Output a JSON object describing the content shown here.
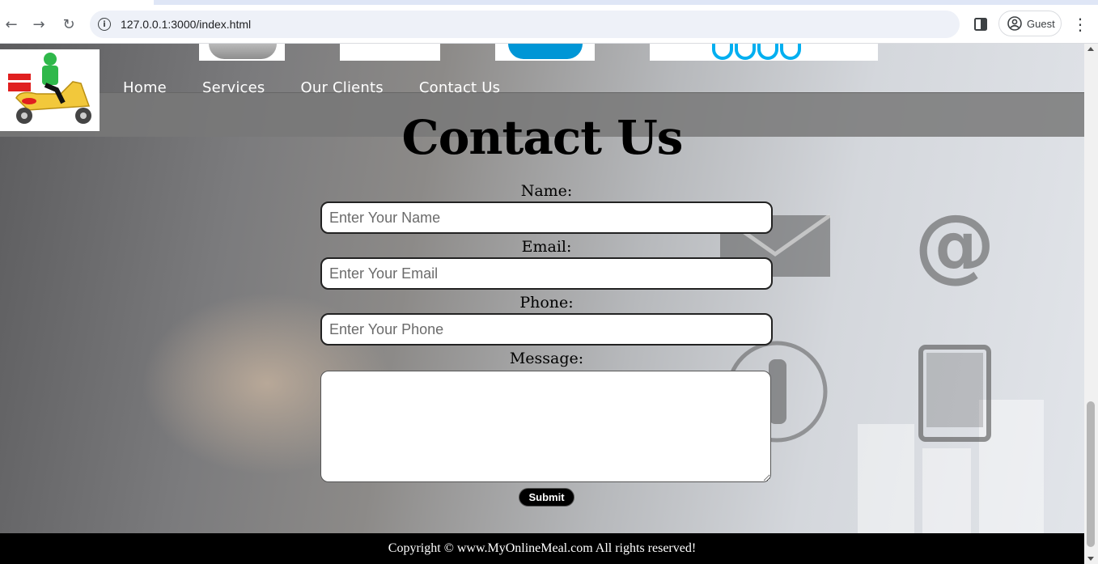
{
  "browser": {
    "url": "127.0.0.1:3000/index.html",
    "profile_label": "Guest"
  },
  "nav": {
    "items": [
      "Home",
      "Services",
      "Our Clients",
      "Contact Us"
    ]
  },
  "contact": {
    "title": "Contact Us",
    "name_label": "Name:",
    "name_placeholder": "Enter Your Name",
    "email_label": "Email:",
    "email_placeholder": "Enter Your Email",
    "phone_label": "Phone:",
    "phone_placeholder": "Enter Your Phone",
    "message_label": "Message:",
    "submit_label": "Submit"
  },
  "footer": {
    "copyright": "Copyright © www.MyOnlineMeal.com All rights reserved!"
  },
  "colors": {
    "footer_bg": "#000000",
    "header_bg": "#787878",
    "nav_text": "#ffffff"
  }
}
